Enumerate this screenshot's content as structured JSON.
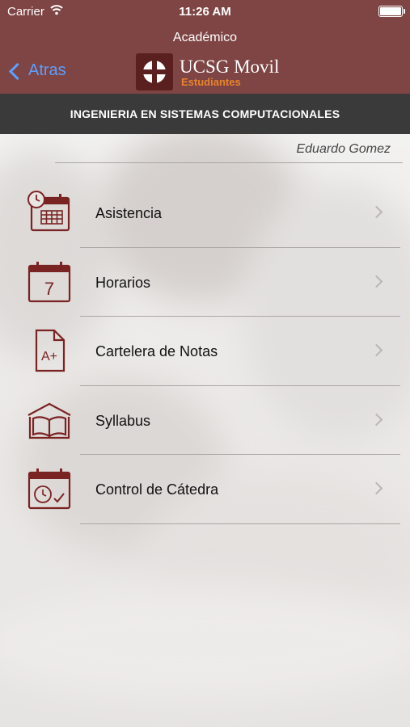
{
  "status_bar": {
    "carrier": "Carrier",
    "time": "11:26 AM"
  },
  "nav": {
    "section_title": "Académico",
    "back_label": "Atras",
    "logo_title": "UCSG Movil",
    "logo_subtitle": "Estudiantes"
  },
  "program": {
    "name": "INGENIERIA EN SISTEMAS COMPUTACIONALES"
  },
  "user": {
    "name": "Eduardo Gomez"
  },
  "menu": {
    "items": [
      {
        "label": "Asistencia",
        "icon": "attendance-calendar-icon"
      },
      {
        "label": "Horarios",
        "icon": "calendar-7-icon"
      },
      {
        "label": "Cartelera de Notas",
        "icon": "grade-document-icon"
      },
      {
        "label": "Syllabus",
        "icon": "open-book-icon"
      },
      {
        "label": "Control de Cátedra",
        "icon": "calendar-clock-check-icon"
      }
    ]
  },
  "colors": {
    "header": "#7f4444",
    "subbar": "#3a3a3a",
    "accent": "#7a2323",
    "link": "#5aa0ff",
    "logo_sub": "#e8842c"
  }
}
